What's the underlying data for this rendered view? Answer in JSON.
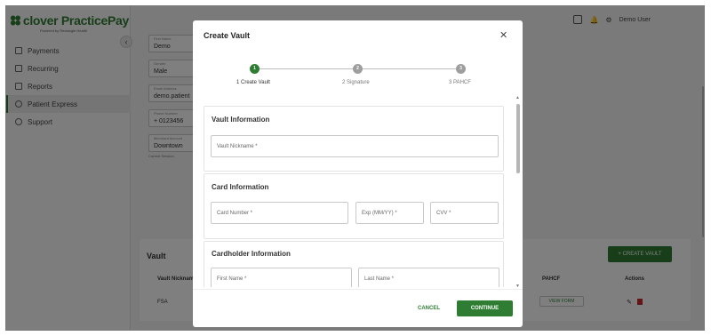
{
  "app": {
    "logo_text": "clover PracticePay",
    "logo_subtitle": "Powered by Rectangle Health",
    "brand_color": "#2e7d32"
  },
  "sidebar": {
    "items": [
      {
        "label": "Payments",
        "icon": "card-icon"
      },
      {
        "label": "Recurring",
        "icon": "recurring-icon"
      },
      {
        "label": "Reports",
        "icon": "reports-icon"
      },
      {
        "label": "Patient Express",
        "icon": "person-icon",
        "active": true
      },
      {
        "label": "Support",
        "icon": "help-icon"
      }
    ],
    "collapse_glyph": "‹"
  },
  "topbar": {
    "user_name": "Demo User"
  },
  "background_form": {
    "fields": [
      {
        "label": "First Name",
        "value": "Demo"
      },
      {
        "label": "Gender",
        "value": "Male"
      },
      {
        "label": "Email Address",
        "value": "demo.patient"
      },
      {
        "label": "Phone Number",
        "value": "+ 0123456"
      },
      {
        "label": "Merchant Account",
        "value": "Downtown"
      }
    ],
    "hint": "Current Session"
  },
  "vault_table": {
    "title": "Vault",
    "create_button": "+ CREATE VAULT",
    "headers": {
      "nickname": "Vault Nickname",
      "pahcf": "PAHCF",
      "actions": "Actions"
    },
    "rows": [
      {
        "nickname": "FSA",
        "pahcf_button": "VIEW FORM"
      }
    ]
  },
  "modal": {
    "title": "Create Vault",
    "close_glyph": "✕",
    "steps": [
      {
        "number": "1",
        "label": "1 Create Vault",
        "active": true
      },
      {
        "number": "2",
        "label": "2 Signature",
        "active": false
      },
      {
        "number": "3",
        "label": "3 PAHCF",
        "active": false
      }
    ],
    "sections": {
      "vault": {
        "title": "Vault Information",
        "nickname_placeholder": "Vault Nickname *"
      },
      "card": {
        "title": "Card Information",
        "number_placeholder": "Card Number *",
        "exp_placeholder": "Exp (MM/YY) *",
        "cvv_placeholder": "CVV *"
      },
      "cardholder": {
        "title": "Cardholder Information",
        "first_name_placeholder": "First Name *",
        "last_name_placeholder": "Last Name *"
      }
    },
    "buttons": {
      "cancel": "CANCEL",
      "continue": "CONTINUE"
    }
  }
}
